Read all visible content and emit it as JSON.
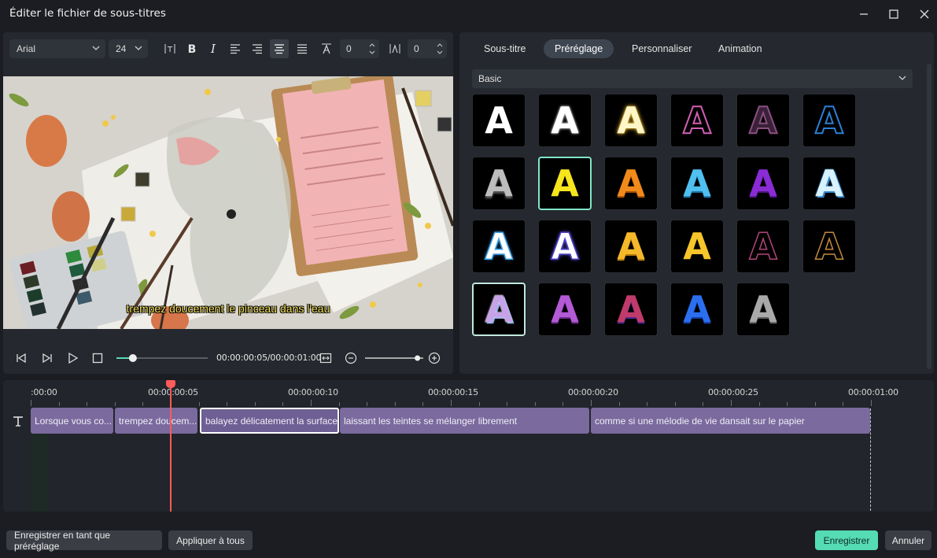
{
  "window": {
    "title": "Éditer le fichier de sous-titres"
  },
  "toolbar": {
    "font": "Arial",
    "size": "24",
    "spacing_value": "0",
    "line_spacing_value": "0"
  },
  "preview": {
    "subtitle_text": "trempez doucement le pinceau dans l'eau",
    "timecode": "00:00:00:05/00:00:01:00",
    "progress": 0.25,
    "zoom": 0.9
  },
  "tabs": [
    {
      "label": "Sous-titre"
    },
    {
      "label": "Préréglage"
    },
    {
      "label": "Personnaliser"
    },
    {
      "label": "Animation"
    }
  ],
  "preset_category": "Basic",
  "preset_glyph": "A",
  "timeline": {
    "ruler": [
      ":00:00",
      "00:00:00:05",
      "00:00:00:10",
      "00:00:00:15",
      "00:00:00:20",
      "00:00:00:25",
      "00:00:01:00"
    ],
    "clips": [
      "Lorsque vous co...",
      "trempez doucem...",
      "balayez délicatement la surface...",
      "laissant les teintes se mélanger librement",
      "comme si une mélodie de vie dansait sur le papier"
    ]
  },
  "footer": {
    "save_preset": "Enregistrer en tant que préréglage",
    "apply_all": "Appliquer à tous",
    "save": "Enregistrer",
    "cancel": "Annuler"
  },
  "colors": {
    "accent": "#55dcb4",
    "clip": "#7a6a9e",
    "playhead": "#ff5b5b",
    "subtitle": "#f4e05a"
  }
}
